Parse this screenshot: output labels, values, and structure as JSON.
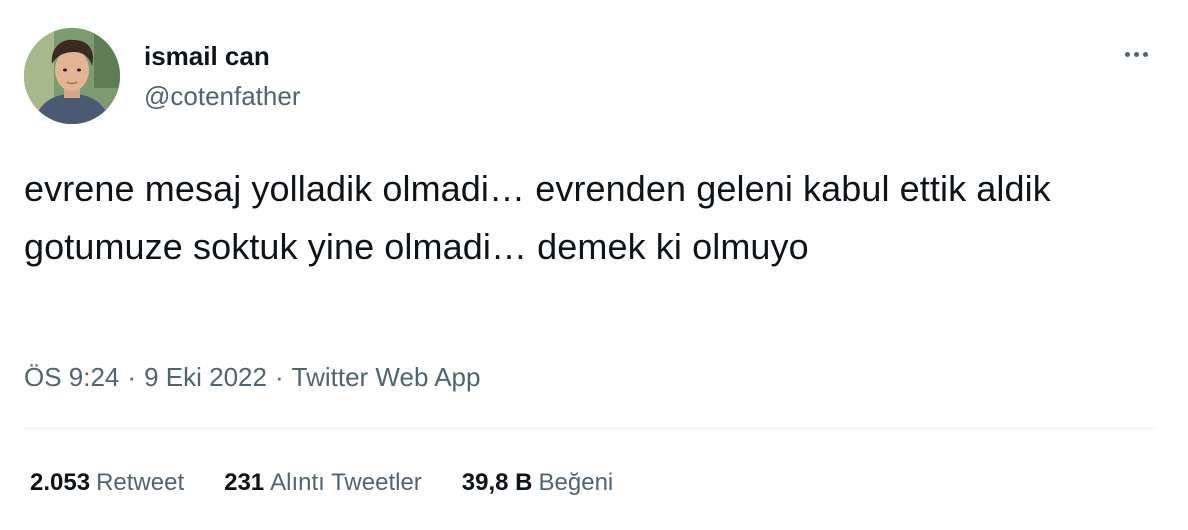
{
  "author": {
    "display_name": "ismail can",
    "handle": "@cotenfather",
    "avatar": "profile-photo"
  },
  "more_icon": "more-horizontal-icon",
  "tweet": {
    "text": "evrene mesaj yolladik olmadi… evrenden geleni kabul ettik aldik gotumuze soktuk yine olmadi… demek ki olmuyo"
  },
  "meta": {
    "time": "ÖS 9:24",
    "separator": "·",
    "date": "9 Eki 2022",
    "source": "Twitter Web App"
  },
  "stats": {
    "retweets": {
      "count": "2.053",
      "label": "Retweet"
    },
    "quotes": {
      "count": "231",
      "label": "Alıntı Tweetler"
    },
    "likes": {
      "count": "39,8 B",
      "label": "Beğeni"
    }
  },
  "colors": {
    "text_primary": "#0f1419",
    "text_secondary": "#536471",
    "divider": "#eff3f4",
    "background": "#ffffff"
  }
}
